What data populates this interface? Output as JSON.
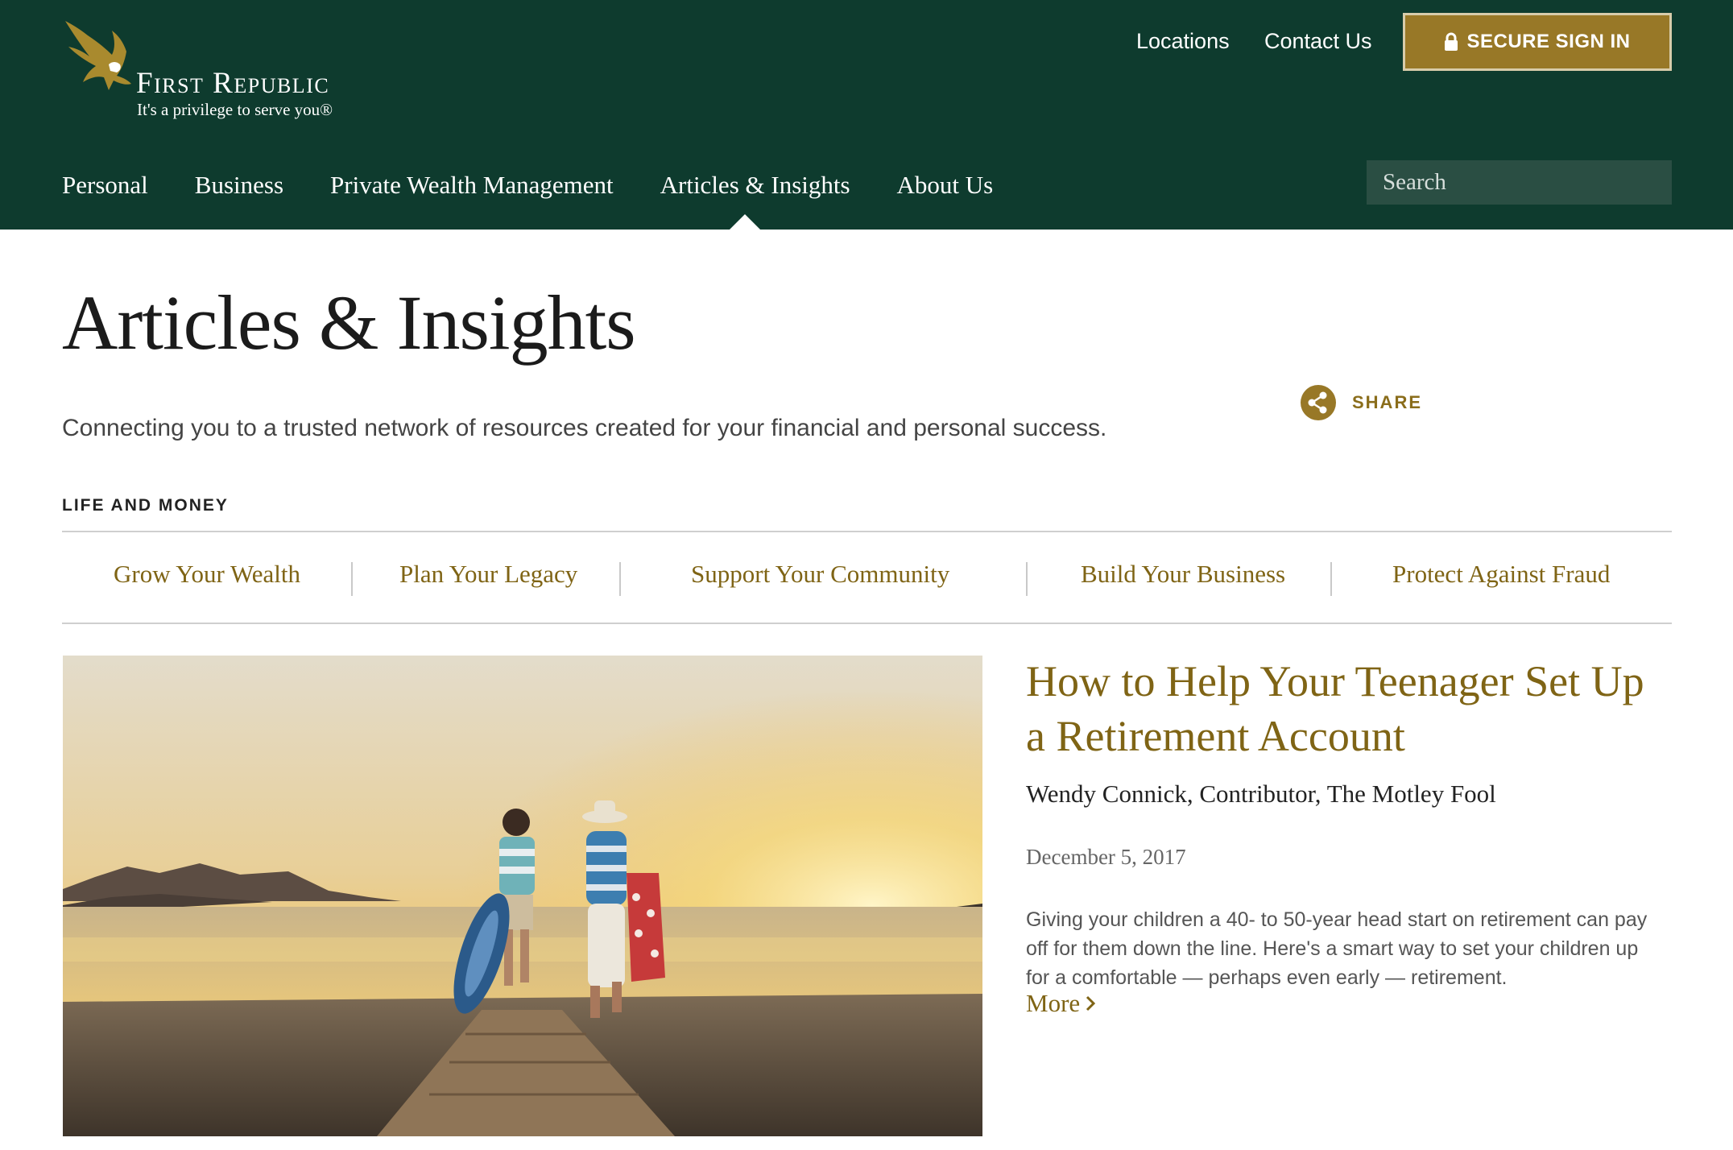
{
  "brand": {
    "name": "First Republic",
    "tagline": "It's a privilege to serve you®"
  },
  "utility_nav": {
    "locations": "Locations",
    "contact": "Contact Us",
    "sign_in": "SECURE SIGN IN"
  },
  "main_nav": {
    "items": [
      {
        "label": "Personal"
      },
      {
        "label": "Business"
      },
      {
        "label": "Private Wealth Management"
      },
      {
        "label": "Articles & Insights"
      },
      {
        "label": "About Us"
      }
    ],
    "active": "Articles & Insights"
  },
  "search": {
    "placeholder": "Search"
  },
  "page": {
    "title": "Articles & Insights",
    "subtitle": "Connecting you to a trusted network of resources created for your financial and personal success.",
    "share_label": "SHARE"
  },
  "section": {
    "label": "LIFE AND MONEY",
    "categories": [
      {
        "label": "Grow Your Wealth"
      },
      {
        "label": "Plan Your Legacy"
      },
      {
        "label": "Support Your Community"
      },
      {
        "label": "Build Your Business"
      },
      {
        "label": "Protect Against Fraud"
      }
    ]
  },
  "featured_article": {
    "title": "How to Help Your Teenager Set Up a Retirement Account",
    "author": "Wendy Connick, Contributor, The Motley Fool",
    "date": "December 5, 2017",
    "summary": "Giving your children a 40- to 50-year head start on retirement can pay off for them down the line. Here's a smart way to set your children up for a comfortable — perhaps even early — retirement.",
    "more_label": "More"
  },
  "colors": {
    "header_bg": "#0e3b2e",
    "gold": "#987827",
    "link_gold": "#7f6415"
  },
  "icons": [
    "eagle-logo-icon",
    "lock-icon",
    "search-icon",
    "share-icon",
    "chevron-right-icon"
  ]
}
